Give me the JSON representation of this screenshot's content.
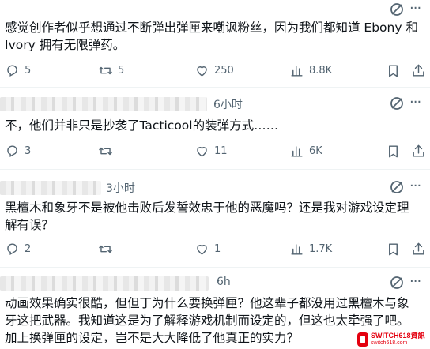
{
  "posts": [
    {
      "time": "",
      "text": "感觉创作者似乎想通过不断弹出弹匣来嘲讽粉丝，因为我们都知道 Ebony 和 Ivory 拥有无限弹药。",
      "replies": "5",
      "reposts": "5",
      "likes": "250",
      "views": "8.8K"
    },
    {
      "time": "6小时",
      "text": "不，他们并非只是抄袭了Tacticool的装弹方式……",
      "replies": "3",
      "reposts": "",
      "likes": "11",
      "views": "6K"
    },
    {
      "time": "3小时",
      "text": "黑檀木和象牙不是被他击败后发誓效忠于他的恶魔吗？还是我对游戏设定理解有误？",
      "replies": "2",
      "reposts": "",
      "likes": "1",
      "views": "1.7K"
    },
    {
      "time": "6h",
      "text": "动画效果确实很酷，但但丁为什么要换弹匣？他这辈子都没用过黑檀木与象牙这把武器。我知道这是为了解释游戏机制而设定的，但这也太牵强了吧。加上换弹匣的设定，岂不是大大降低了他真正的实力？"
    }
  ],
  "menu_glyph": "···",
  "watermark": {
    "main": "SWITCH618",
    "cjk": "資訊",
    "sub": "switch618.com"
  },
  "colors": {
    "text": "#0f1419",
    "muted": "#536471",
    "divider": "#eff3f4",
    "watermark": "#e4000f"
  }
}
